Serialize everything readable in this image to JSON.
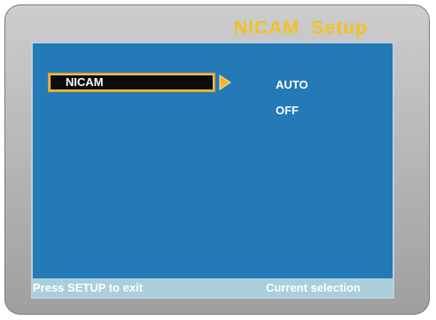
{
  "screen": {
    "title": "NICAM  Setup"
  },
  "menu": {
    "selected_item": "NICAM",
    "pointer_icon": "right-triangle-pointer-icon",
    "options": [
      "AUTO",
      "OFF"
    ]
  },
  "status_bar": {
    "left_text": "Press SETUP to exit",
    "right_text": "Current selection"
  },
  "colors": {
    "title": "#f2c21f",
    "panel": "#2479b7",
    "highlight_border": "#d9a530",
    "status_bar": "#a9cfdb",
    "frame": "#b5b5b5"
  }
}
